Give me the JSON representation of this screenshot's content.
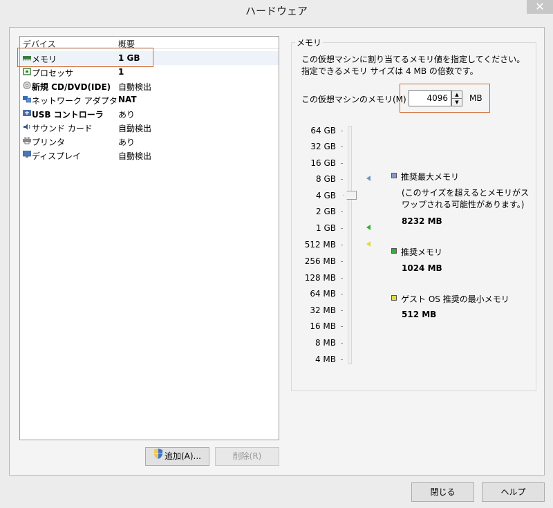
{
  "window": {
    "title": "ハードウェア",
    "close_glyph": "✕"
  },
  "device_list": {
    "col_device": "デバイス",
    "col_summary": "概要",
    "rows": [
      {
        "name": "メモリ",
        "summary": "1 GB",
        "icon": "memory-icon",
        "selected": true
      },
      {
        "name": "プロセッサ",
        "summary": "1",
        "icon": "processor-icon"
      },
      {
        "name": "新規 CD/DVD(IDE)",
        "summary": "自動検出",
        "icon": "cd-dvd-icon"
      },
      {
        "name": "ネットワーク アダプタ",
        "summary": "NAT",
        "icon": "network-adapter-icon"
      },
      {
        "name": "USB コントローラ",
        "summary": "あり",
        "icon": "usb-icon"
      },
      {
        "name": "サウンド カード",
        "summary": "自動検出",
        "icon": "sound-card-icon"
      },
      {
        "name": "プリンタ",
        "summary": "あり",
        "icon": "printer-icon"
      },
      {
        "name": "ディスプレイ",
        "summary": "自動検出",
        "icon": "display-icon"
      }
    ],
    "add_button": "追加(A)...",
    "remove_button": "削除(R)"
  },
  "memory": {
    "group_title": "メモリ",
    "description": "この仮想マシンに割り当てるメモリ値を指定してください。指定できるメモリ サイズは 4 MB の倍数です。",
    "label": "この仮想マシンのメモリ(M)",
    "value": "4096",
    "unit": "MB",
    "scale": [
      "64 GB",
      "32 GB",
      "16 GB",
      "8 GB",
      "4 GB",
      "2 GB",
      "1 GB",
      "512 MB",
      "256 MB",
      "128 MB",
      "64 MB",
      "32 MB",
      "16 MB",
      "8 MB",
      "4 MB"
    ],
    "slider_value": "4 GB",
    "legend": {
      "max": {
        "label": "推奨最大メモリ",
        "note": "(このサイズを超えるとメモリがスワップされる可能性があります。)",
        "value": "8232 MB",
        "color": "#7d9ccc"
      },
      "recommended": {
        "label": "推奨メモリ",
        "value": "1024 MB",
        "color": "#3ca83c"
      },
      "min": {
        "label": "ゲスト OS 推奨の最小メモリ",
        "value": "512 MB",
        "color": "#e2da3a"
      }
    }
  },
  "footer": {
    "close_button": "閉じる",
    "help_button": "ヘルプ"
  },
  "colors": {
    "highlight_border": "#d0662f"
  }
}
